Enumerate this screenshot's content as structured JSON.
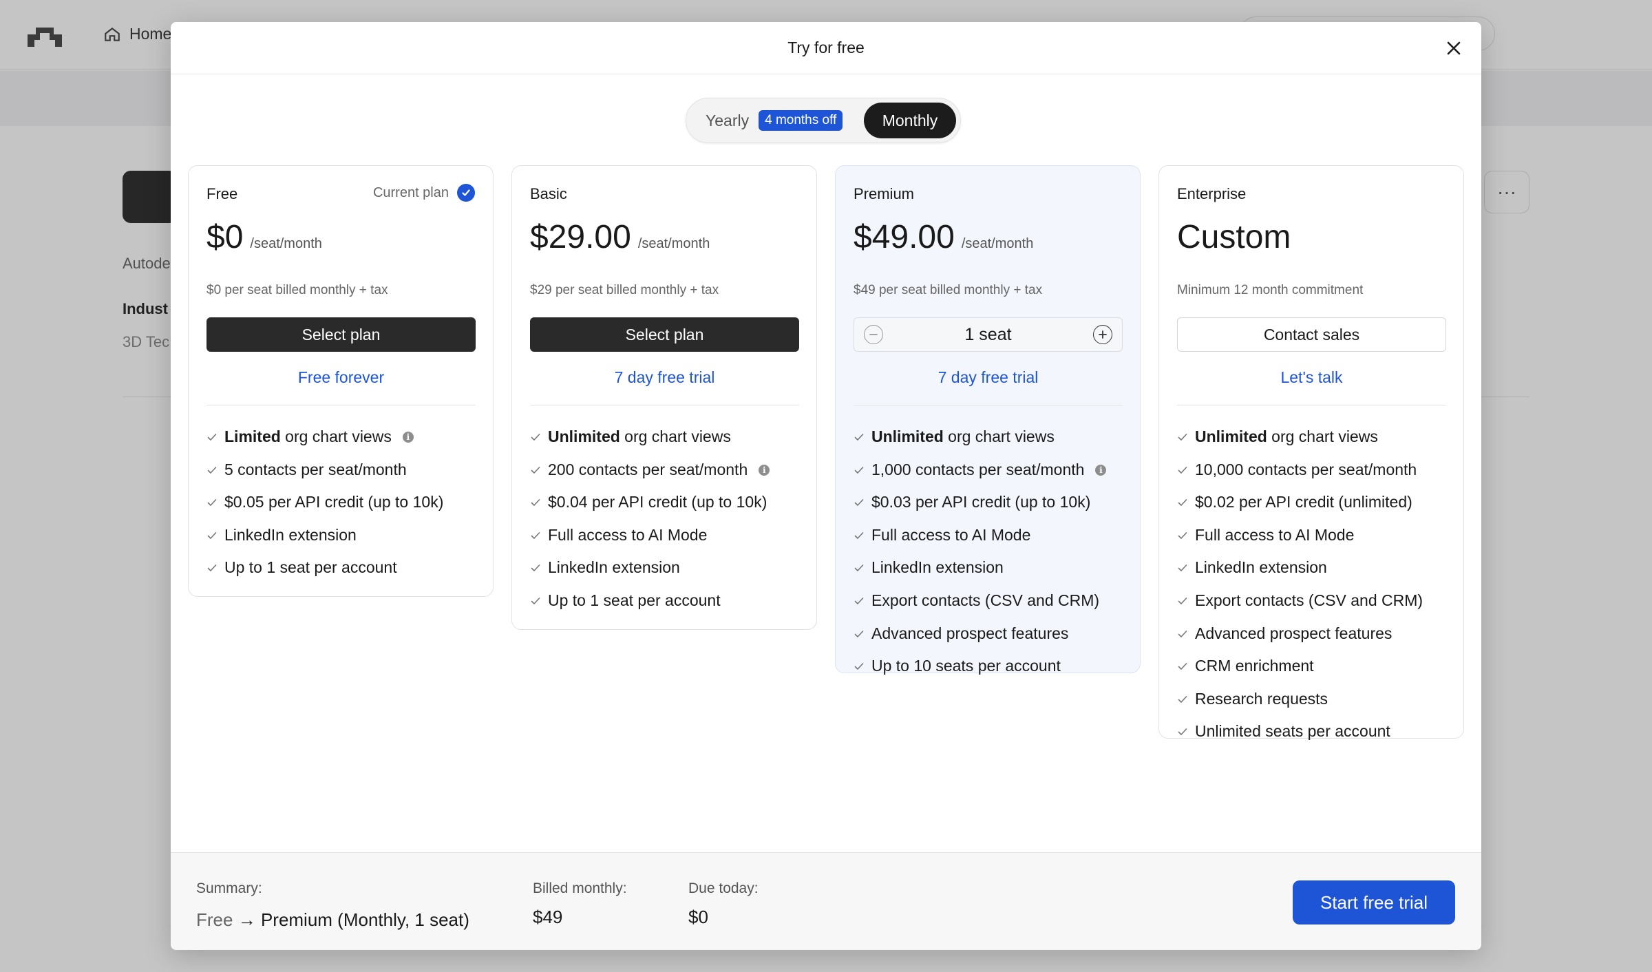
{
  "background": {
    "nav_home_label": "Home",
    "company_text": "Autode",
    "industry_label": "Indust",
    "industry_value": "3D Tec"
  },
  "modal": {
    "title": "Try for free",
    "billing_toggle": {
      "yearly_label": "Yearly",
      "yearly_badge": "4 months off",
      "monthly_label": "Monthly",
      "selected": "Monthly"
    },
    "plans": [
      {
        "name": "Free",
        "current_plan_label": "Current plan",
        "price": "$0",
        "price_unit": "/seat/month",
        "billing_note": "$0 per seat billed monthly + tax",
        "button_label": "Select plan",
        "trial_link": "Free forever",
        "features": [
          {
            "bold": "Limited",
            "text": " org chart views",
            "info": true
          },
          {
            "bold": "",
            "text": "5 contacts per seat/month",
            "info": false
          },
          {
            "bold": "",
            "text": "$0.05 per API credit (up to 10k)",
            "info": false
          },
          {
            "bold": "",
            "text": "LinkedIn extension",
            "info": false
          },
          {
            "bold": "",
            "text": "Up to 1 seat per account",
            "info": false
          }
        ]
      },
      {
        "name": "Basic",
        "price": "$29.00",
        "price_unit": "/seat/month",
        "billing_note": "$29 per seat billed monthly + tax",
        "button_label": "Select plan",
        "trial_link": "7 day free trial",
        "features": [
          {
            "bold": "Unlimited",
            "text": " org chart views",
            "info": false
          },
          {
            "bold": "",
            "text": "200 contacts per seat/month",
            "info": true
          },
          {
            "bold": "",
            "text": "$0.04 per API credit (up to 10k)",
            "info": false
          },
          {
            "bold": "",
            "text": "Full access to AI Mode",
            "info": false
          },
          {
            "bold": "",
            "text": "LinkedIn extension",
            "info": false
          },
          {
            "bold": "",
            "text": "Up to 1 seat per account",
            "info": false
          }
        ]
      },
      {
        "name": "Premium",
        "price": "$49.00",
        "price_unit": "/seat/month",
        "billing_note": "$49 per seat billed monthly + tax",
        "seat_value": "1 seat",
        "trial_link": "7 day free trial",
        "features": [
          {
            "bold": "Unlimited",
            "text": " org chart views",
            "info": false
          },
          {
            "bold": "",
            "text": "1,000 contacts per seat/month",
            "info": true
          },
          {
            "bold": "",
            "text": "$0.03 per API credit (up to 10k)",
            "info": false
          },
          {
            "bold": "",
            "text": "Full access to AI Mode",
            "info": false
          },
          {
            "bold": "",
            "text": "LinkedIn extension",
            "info": false
          },
          {
            "bold": "",
            "text": "Export contacts (CSV and CRM)",
            "info": false
          },
          {
            "bold": "",
            "text": "Advanced prospect features",
            "info": false
          },
          {
            "bold": "",
            "text": "Up to 10 seats per account",
            "info": false
          }
        ]
      },
      {
        "name": "Enterprise",
        "price": "Custom",
        "billing_note": "Minimum 12 month commitment",
        "button_label": "Contact sales",
        "trial_link": "Let's talk",
        "features": [
          {
            "bold": "Unlimited",
            "text": " org chart views",
            "info": false
          },
          {
            "bold": "",
            "text": "10,000 contacts per seat/month",
            "info": false
          },
          {
            "bold": "",
            "text": "$0.02 per API credit (unlimited)",
            "info": false
          },
          {
            "bold": "",
            "text": "Full access to AI Mode",
            "info": false
          },
          {
            "bold": "",
            "text": "LinkedIn extension",
            "info": false
          },
          {
            "bold": "",
            "text": "Export contacts (CSV and CRM)",
            "info": false
          },
          {
            "bold": "",
            "text": "Advanced prospect features",
            "info": false
          },
          {
            "bold": "",
            "text": "CRM enrichment",
            "info": false
          },
          {
            "bold": "",
            "text": "Research requests",
            "info": false
          },
          {
            "bold": "",
            "text": "Unlimited seats per account",
            "info": false
          }
        ]
      }
    ],
    "summary": {
      "summary_label": "Summary:",
      "from_plan": "Free",
      "arrow": "→",
      "to_plan": "Premium (Monthly, 1 seat)",
      "billed_label": "Billed monthly:",
      "billed_value": "$49",
      "due_label": "Due today:",
      "due_value": "$0",
      "cta_label": "Start free trial"
    }
  },
  "colors": {
    "accent": "#1d55d6",
    "dark_button": "#2a2a2a",
    "highlight_card": "#f3f6fd"
  },
  "icons": {
    "close": "close-icon",
    "check": "check-icon",
    "info": "info-icon",
    "current": "check-circle-icon",
    "minus": "minus-icon",
    "plus": "plus-icon"
  }
}
